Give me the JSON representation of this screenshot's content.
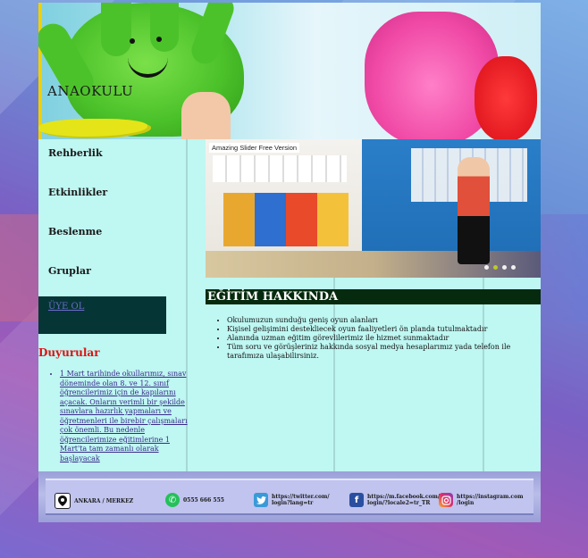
{
  "header": {
    "title": "ANAOKULU"
  },
  "sidebar": {
    "items": [
      {
        "label": "Rehberlik"
      },
      {
        "label": "Etkinlikler"
      },
      {
        "label": "Beslenme"
      },
      {
        "label": "Gruplar"
      }
    ],
    "signup_label": "ÜYE OL"
  },
  "announcements": {
    "heading": "Duyurular",
    "items": [
      "1 Mart tarihinde okullarımız, sınav döneminde olan 8. ve 12. sınıf öğrencilerimiz için de kapılarını açacak. Onların verimli bir şekilde sınavlara hazırlık yapmaları ve öğretmenleri ile birebir çalışmaları çok önemli. Bu nedenle öğrencilerimize eğitimlerine 1 Mart'ta tam zamanlı olarak başlayacak"
    ]
  },
  "slider": {
    "caption": "Amazing Slider Free Version",
    "dot_count": 4,
    "active_dot": 1
  },
  "section": {
    "title": "EĞİTİM HAKKINDA",
    "items": [
      "Okulumuzun sunduğu geniş oyun alanları",
      "Kişisel gelişimini destekliecek oyun faaliyetleri ön planda tutulmaktadır",
      "Alanında uzman eğitim görevlilerimiz ile hizmet sunmaktadır",
      "Tüm soru ve görüşleriniz hakkında sosyal medya hesaplarımız yada telefon ile tarafımıza ulaşabilirsiniz."
    ]
  },
  "footer": {
    "location": "ANKARA / MERKEZ",
    "phone": "0555 666 555",
    "twitter_line1": "https://twitter.com/",
    "twitter_line2": "login?lang=tr",
    "facebook_line1": "https://m.facebook.com/",
    "facebook_line2": "login/?locale2=tr_TR",
    "instagram_line1": "https://instagram.com",
    "instagram_line2": "/login"
  },
  "colors": {
    "signup_box": "#063536",
    "section_title_bg": "#062a0e",
    "announcement_heading": "#e01010",
    "page_bg": "#bff7f2"
  }
}
